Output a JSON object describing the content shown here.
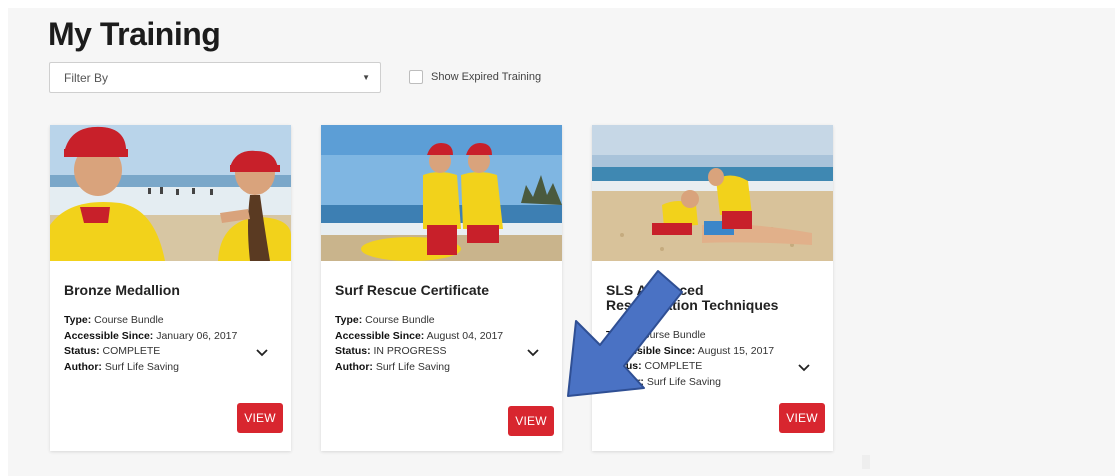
{
  "page": {
    "title": "My Training"
  },
  "filters": {
    "filter_label": "Filter By",
    "show_expired_label": "Show Expired Training"
  },
  "cards": [
    {
      "title": "Bronze Medallion",
      "type_label": "Type:",
      "type_value": "Course Bundle",
      "since_label": "Accessible Since:",
      "since_value": "January 06, 2017",
      "status_label": "Status:",
      "status_value": "COMPLETE",
      "author_label": "Author:",
      "author_value": "Surf Life Saving",
      "view_label": "VIEW"
    },
    {
      "title": "Surf Rescue Certificate",
      "type_label": "Type:",
      "type_value": "Course Bundle",
      "since_label": "Accessible Since:",
      "since_value": "August 04, 2017",
      "status_label": "Status:",
      "status_value": "IN PROGRESS",
      "author_label": "Author:",
      "author_value": "Surf Life Saving",
      "view_label": "VIEW"
    },
    {
      "title_line1": "SLS Advanced",
      "title_line2": "Resuscitation Techniques",
      "type_label": "Type:",
      "type_value": "Course Bundle",
      "since_label": "Accessible Since:",
      "since_value": "August 15, 2017",
      "status_label": "Status:",
      "status_value": "COMPLETE",
      "author_label": "Author:",
      "author_value": "Surf Life Saving",
      "view_label": "VIEW"
    }
  ],
  "colors": {
    "view_button": "#d8262f",
    "annotation_arrow": "#4a72c4",
    "lifesaver_yellow": "#f2d21b",
    "lifesaver_red": "#c8202a"
  }
}
